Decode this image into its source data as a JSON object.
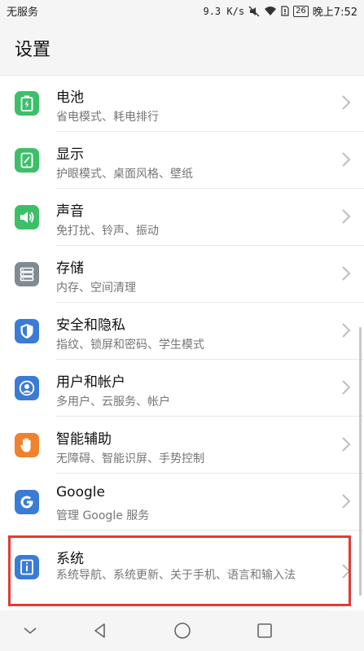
{
  "status_bar": {
    "carrier": "无服务",
    "net_speed": "9.3 K/s",
    "battery": "26",
    "time": "晚上7:52",
    "icons": [
      "mute-icon",
      "wifi-icon",
      "sim-icon",
      "battery-icon"
    ]
  },
  "header": {
    "title": "设置"
  },
  "settings": [
    {
      "title": "电池",
      "subtitle": "省电模式、耗电排行",
      "icon": "battery-icon",
      "color": "#3dbf6a"
    },
    {
      "title": "显示",
      "subtitle": "护眼模式、桌面风格、壁纸",
      "icon": "display-icon",
      "color": "#3dbf6a"
    },
    {
      "title": "声音",
      "subtitle": "免打扰、铃声、振动",
      "icon": "sound-icon",
      "color": "#3dbf6a"
    },
    {
      "title": "存储",
      "subtitle": "内存、空间清理",
      "icon": "storage-icon",
      "color": "#7f8a93"
    },
    {
      "title": "安全和隐私",
      "subtitle": "指纹、锁屏和密码、学生模式",
      "icon": "shield-icon",
      "color": "#3a7bd5"
    },
    {
      "title": "用户和帐户",
      "subtitle": "多用户、云服务、帐户",
      "icon": "user-icon",
      "color": "#3a7bd5"
    },
    {
      "title": "智能辅助",
      "subtitle": "无障碍、智能识屏、手势控制",
      "icon": "hand-icon",
      "color": "#f0822d"
    },
    {
      "title": "Google",
      "subtitle": "管理 Google 服务",
      "icon": "google-icon",
      "color": "#3a7bd5"
    },
    {
      "title": "系统",
      "subtitle": "系统导航、系统更新、关于手机、语言和输入法",
      "icon": "info-icon",
      "color": "#3a7bd5"
    }
  ],
  "nav_bar": {
    "icons": [
      "hide-icon",
      "back-icon",
      "home-icon",
      "recents-icon"
    ]
  }
}
